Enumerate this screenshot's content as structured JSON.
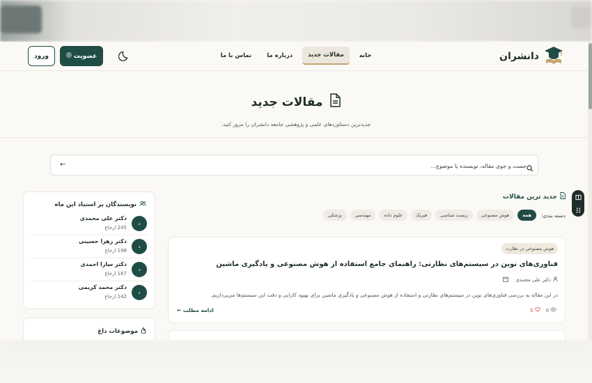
{
  "nav": {
    "logo_text": "دانشران",
    "links": [
      "خانه",
      "مقالات جدید",
      "درباره ما",
      "تماس با ما"
    ],
    "active_link": "مقالات جدید",
    "signup_label": "عضویت",
    "login_label": "ورود"
  },
  "hero": {
    "title": "مقالات جدید",
    "subtitle": "جدیدترین دستاوردهای علمی و پژوهشی جامعه دانشران را مرور کنید."
  },
  "search": {
    "placeholder": "جست و جوی مقاله، نویسنده یا موضوع..."
  },
  "sidebar": {
    "authors_title": "نویسندگان پر استناد این ماه",
    "authors": [
      {
        "initial": "د",
        "name": "دکتر علی محمدی",
        "count": "245 ارجاع"
      },
      {
        "initial": "د",
        "name": "دکتر زهرا حسینی",
        "count": "198 ارجاع"
      },
      {
        "initial": "د",
        "name": "دکتر سارا احمدی",
        "count": "167 ارجاع"
      },
      {
        "initial": "د",
        "name": "دکتر محمد کریمی",
        "count": "142 ارجاع"
      }
    ],
    "topics_title": "موضوعات داغ"
  },
  "main": {
    "section_title": "جدید ترین مقالات",
    "category_label": "دسته بندی:",
    "categories": [
      "همه",
      "هوش مصنوعی",
      "زیست شناسی",
      "فیزیک",
      "علوم داده",
      "مهندسی",
      "پزشکی"
    ],
    "active_category": "همه",
    "article": {
      "tag": "هوش مصنوعی در نظارت",
      "title": "فناوری‌های نوین در سیستم‌های نظارتی: راهنمای جامع استفاده از هوش مصنوعی و یادگیری ماشین",
      "author": "دکتر علی محمدی",
      "excerpt": "در این مقاله به بررسی فناوری‌های نوین در سیستم‌های نظارتی و استفاده از هوش مصنوعی و یادگیری ماشین برای بهبود کارایی و دقت این سیستم‌ها می‌پردازیم.",
      "read_more": "ادامه مطلب",
      "views": "0",
      "likes": "0"
    }
  },
  "colors": {
    "primary": "#1f4d45",
    "background": "#fbf9f5",
    "accent": "#c4a46d"
  }
}
